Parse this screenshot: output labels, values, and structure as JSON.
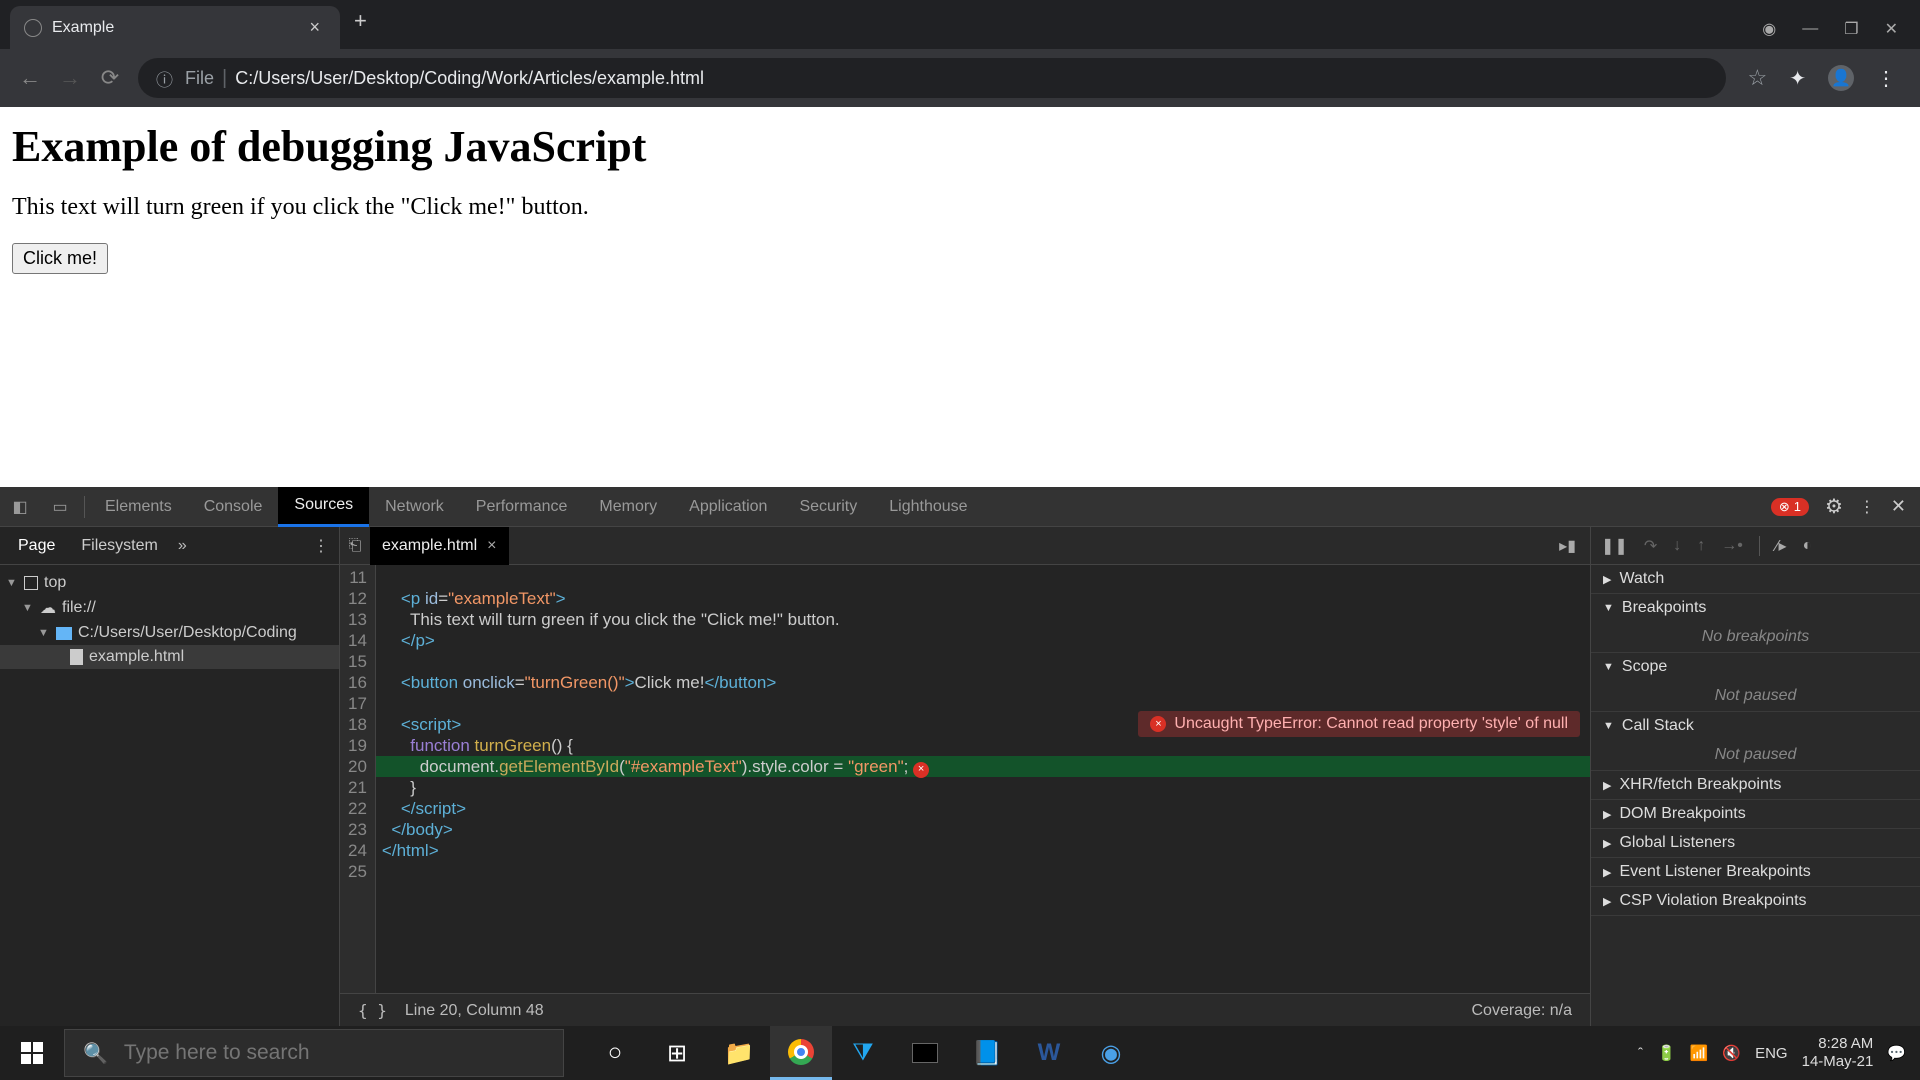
{
  "browser": {
    "tab_title": "Example",
    "addr_scheme": "File",
    "addr_path": "C:/Users/User/Desktop/Coding/Work/Articles/example.html"
  },
  "page": {
    "heading": "Example of debugging JavaScript",
    "paragraph": "This text will turn green if you click the \"Click me!\" button.",
    "button_label": "Click me!"
  },
  "devtools": {
    "tabs": [
      "Elements",
      "Console",
      "Sources",
      "Network",
      "Performance",
      "Memory",
      "Application",
      "Security",
      "Lighthouse"
    ],
    "active_tab": "Sources",
    "error_count": "1",
    "navigator": {
      "tabs": [
        "Page",
        "Filesystem"
      ],
      "tree_top": "top",
      "tree_scheme": "file://",
      "tree_folder": "C:/Users/User/Desktop/Coding",
      "tree_file": "example.html"
    },
    "editor": {
      "filename": "example.html",
      "lines": [
        {
          "n": 11,
          "html": ""
        },
        {
          "n": 12,
          "html": "    <span class='tok-tag'>&lt;p</span> <span class='tok-attr'>id</span>=<span class='tok-str'>\"exampleText\"</span><span class='tok-tag'>&gt;</span>"
        },
        {
          "n": 13,
          "html": "      This text will turn green if you click the \"Click me!\" button."
        },
        {
          "n": 14,
          "html": "    <span class='tok-tag'>&lt;/p&gt;</span>"
        },
        {
          "n": 15,
          "html": ""
        },
        {
          "n": 16,
          "html": "    <span class='tok-tag'>&lt;button</span> <span class='tok-attr'>onclick</span>=<span class='tok-str'>\"turnGreen()\"</span><span class='tok-tag'>&gt;</span>Click me!<span class='tok-tag'>&lt;/button&gt;</span>"
        },
        {
          "n": 17,
          "html": ""
        },
        {
          "n": 18,
          "html": "    <span class='tok-tag'>&lt;script&gt;</span>"
        },
        {
          "n": 19,
          "html": "      <span class='tok-kw'>function</span> <span class='tok-fn'>turnGreen</span>() {"
        },
        {
          "n": 20,
          "html": "        document.<span class='tok-method'>getElementById</span>(<span class='tok-str'>\"#exampleText\"</span>).style.color <span class='tok-op'>=</span> <span class='tok-str'>\"green\"</span>; <span class='line-dot'>×</span>",
          "err": true
        },
        {
          "n": 21,
          "html": "      }"
        },
        {
          "n": 22,
          "html": "    <span class='tok-tag'>&lt;/script&gt;</span>"
        },
        {
          "n": 23,
          "html": "  <span class='tok-tag'>&lt;/body&gt;</span>"
        },
        {
          "n": 24,
          "html": "<span class='tok-tag'>&lt;/html&gt;</span>"
        },
        {
          "n": 25,
          "html": ""
        }
      ],
      "inline_error": "Uncaught TypeError: Cannot read property 'style' of null",
      "status_pos": "Line 20, Column 48",
      "coverage": "Coverage: n/a"
    },
    "debugger": {
      "sections": [
        {
          "title": "Watch",
          "open": false
        },
        {
          "title": "Breakpoints",
          "open": true,
          "body": "No breakpoints"
        },
        {
          "title": "Scope",
          "open": true,
          "body": "Not paused"
        },
        {
          "title": "Call Stack",
          "open": true,
          "body": "Not paused"
        },
        {
          "title": "XHR/fetch Breakpoints",
          "open": false
        },
        {
          "title": "DOM Breakpoints",
          "open": false
        },
        {
          "title": "Global Listeners",
          "open": false
        },
        {
          "title": "Event Listener Breakpoints",
          "open": false
        },
        {
          "title": "CSP Violation Breakpoints",
          "open": false
        }
      ]
    }
  },
  "taskbar": {
    "search_placeholder": "Type here to search",
    "lang": "ENG",
    "time": "8:28 AM",
    "date": "14-May-21"
  }
}
